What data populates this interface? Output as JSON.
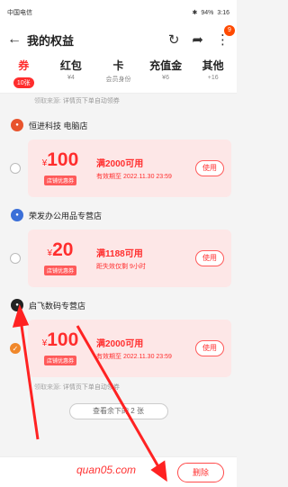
{
  "status": {
    "carrier": "中国电信",
    "battery": "94%",
    "time": "3:16"
  },
  "header": {
    "title": "我的权益",
    "back": "←",
    "cart_badge": "9"
  },
  "tabs": [
    {
      "label": "券",
      "sub": "10张"
    },
    {
      "label": "红包",
      "sub": "¥4"
    },
    {
      "label": "卡",
      "sub": "会员身份"
    },
    {
      "label": "充值金",
      "sub": "¥6"
    },
    {
      "label": "其他",
      "sub": "+16"
    }
  ],
  "source_prefix": "领取来源:",
  "source_text": "详情页下单自动领券",
  "shops": [
    {
      "name": "恒进科技 电脑店",
      "logo_color": "#e8542d",
      "coupon": {
        "currency": "¥",
        "amount": "100",
        "tag": "店铺优惠券",
        "condition": "满2000可用",
        "valid": "有效期至 2022.11.30 23:59",
        "use": "使用"
      }
    },
    {
      "name": "荣发办公用品专营店",
      "logo_color": "#3b6fd8",
      "coupon": {
        "currency": "¥",
        "amount": "20",
        "tag": "店铺优惠券",
        "condition": "满1188可用",
        "valid": "距失效仅剩 9小时",
        "use": "使用"
      }
    },
    {
      "name": "启飞数码专营店",
      "logo_color": "#222222",
      "coupon": {
        "currency": "¥",
        "amount": "100",
        "tag": "店铺优惠券",
        "condition": "满2000可用",
        "valid": "有效期至 2022.11.30 23:59",
        "use": "使用"
      }
    }
  ],
  "more": "查看余下的 2 张",
  "watermark": "quan05.com",
  "delete": "删除"
}
